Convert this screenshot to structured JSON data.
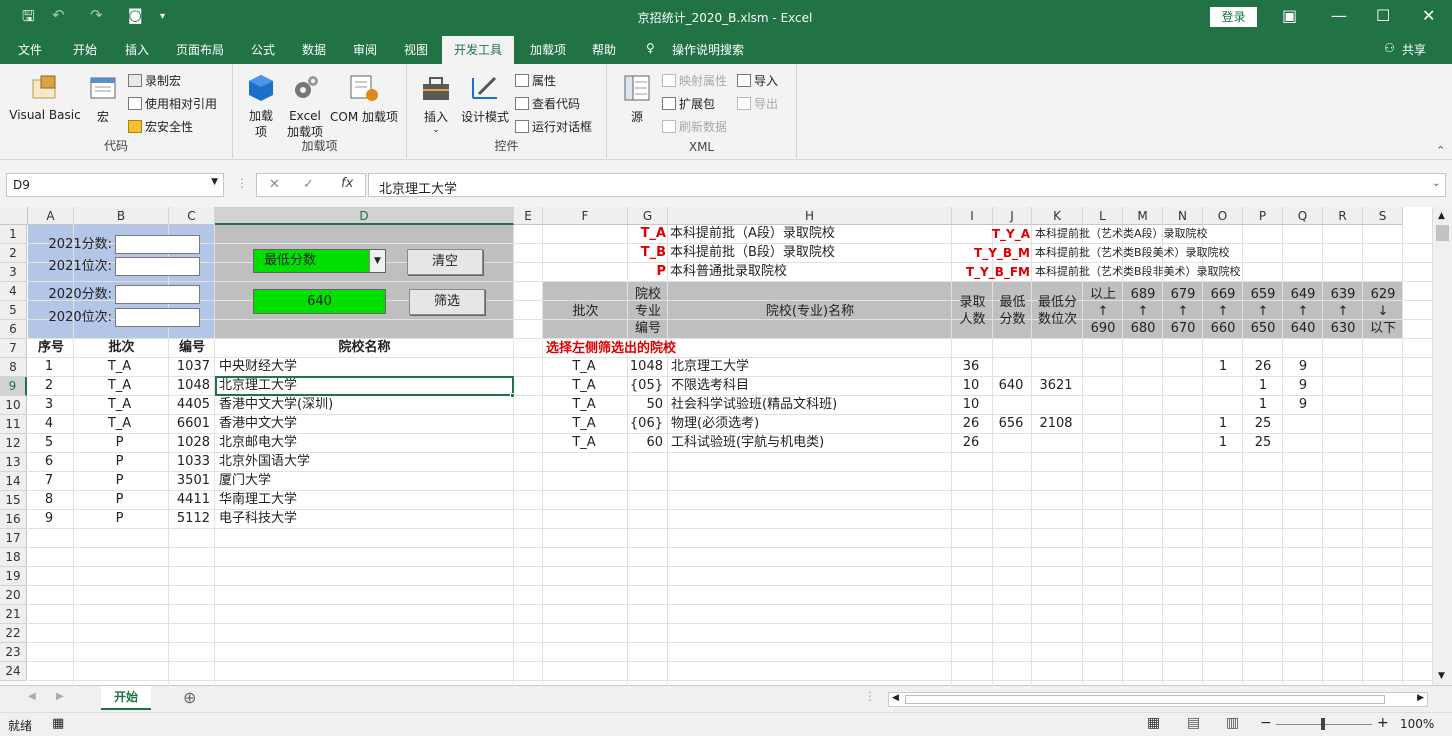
{
  "app": {
    "title": "京招统计_2020_B.xlsm  -  Excel",
    "login": "登录"
  },
  "menu": {
    "tabs": [
      "文件",
      "开始",
      "插入",
      "页面布局",
      "公式",
      "数据",
      "审阅",
      "视图",
      "开发工具",
      "加载项",
      "帮助"
    ],
    "active_tab": "开发工具",
    "search": "操作说明搜索",
    "share": "共享"
  },
  "ribbon": {
    "code": {
      "label": "代码",
      "visual_basic": "Visual Basic",
      "macro": "宏",
      "record": "录制宏",
      "relative": "使用相对引用",
      "security": "宏安全性"
    },
    "addins": {
      "label": "加载项",
      "addin": "加载项",
      "excel_addin": "Excel 加载项",
      "com_addin": "COM 加载项"
    },
    "controls": {
      "label": "控件",
      "insert": "插入",
      "design": "设计模式",
      "props": "属性",
      "view_code": "查看代码",
      "dialog": "运行对话框"
    },
    "xml": {
      "label": "XML",
      "source": "源",
      "map_props": "映射属性",
      "expansion": "扩展包",
      "refresh": "刷新数据",
      "import": "导入",
      "export": "导出"
    }
  },
  "formula": {
    "namebox": "D9",
    "value": "北京理工大学"
  },
  "columns": [
    "A",
    "B",
    "C",
    "D",
    "E",
    "F",
    "G",
    "H",
    "I",
    "J",
    "K",
    "L",
    "M",
    "N",
    "O",
    "P",
    "Q",
    "R",
    "S"
  ],
  "rows": [
    "1",
    "2",
    "3",
    "4",
    "5",
    "6",
    "7",
    "8",
    "9",
    "10",
    "11",
    "12",
    "13",
    "14",
    "15",
    "16",
    "17",
    "18",
    "19",
    "20",
    "21",
    "22",
    "23",
    "24"
  ],
  "panel": {
    "score2021": "2021分数:",
    "rank2021": "2021位次:",
    "score2020": "2020分数:",
    "rank2020": "2020位次:",
    "dropdown": "最低分数",
    "value": "640",
    "clear": "清空",
    "filter": "筛选"
  },
  "left_table": {
    "headers": [
      "序号",
      "批次",
      "编号",
      "院校名称"
    ],
    "rows": [
      [
        "1",
        "T_A",
        "1037",
        "中央财经大学"
      ],
      [
        "2",
        "T_A",
        "1048",
        "北京理工大学"
      ],
      [
        "3",
        "T_A",
        "4405",
        "香港中文大学(深圳)"
      ],
      [
        "4",
        "T_A",
        "6601",
        "香港中文大学"
      ],
      [
        "5",
        "P",
        "1028",
        "北京邮电大学"
      ],
      [
        "6",
        "P",
        "1033",
        "北京外国语大学"
      ],
      [
        "7",
        "P",
        "3501",
        "厦门大学"
      ],
      [
        "8",
        "P",
        "4411",
        "华南理工大学"
      ],
      [
        "9",
        "P",
        "5112",
        "电子科技大学"
      ]
    ]
  },
  "legend": [
    {
      "code": "T_A",
      "desc": "本科提前批（A段）录取院校"
    },
    {
      "code": "T_B",
      "desc": "本科提前批（B段）录取院校"
    },
    {
      "code": "P",
      "desc": "本科普通批录取院校"
    },
    {
      "code": "T_Y_A",
      "desc": "本科提前批（艺术类A段）录取院校"
    },
    {
      "code": "T_Y_B_M",
      "desc": "本科提前批（艺术类B段美术）录取院校"
    },
    {
      "code": "T_Y_B_FM",
      "desc": "本科提前批（艺术类B段非美术）录取院校"
    }
  ],
  "right_header": {
    "batch": "批次",
    "code": "院校\n专业\n编号",
    "name": "院校(专业)名称",
    "enroll": "录取\n人数",
    "min": "最低\n分数",
    "minrank": "最低分\n数位次",
    "bands": [
      "以上\n↑\n690",
      "689\n↑\n680",
      "679\n↑\n670",
      "669\n↑\n660",
      "659\n↑\n650",
      "649\n↑\n640",
      "639\n↑\n630",
      "629\n↓\n以下"
    ]
  },
  "right_title": "选择左侧筛选出的院校",
  "right_rows": [
    {
      "batch": "T_A",
      "code": "1048",
      "name": "北京理工大学",
      "enroll": "36",
      "min": "",
      "rank": "",
      "bands": [
        "",
        "",
        "",
        "1",
        "26",
        "9",
        "",
        ""
      ]
    },
    {
      "batch": "T_A",
      "code": "{05}",
      "name": "不限选考科目",
      "enroll": "10",
      "min": "640",
      "rank": "3621",
      "bands": [
        "",
        "",
        "",
        "",
        "1",
        "9",
        "",
        ""
      ]
    },
    {
      "batch": "T_A",
      "code": "50",
      "name": "社会科学试验班(精品文科班)",
      "enroll": "10",
      "min": "",
      "rank": "",
      "bands": [
        "",
        "",
        "",
        "",
        "1",
        "9",
        "",
        ""
      ]
    },
    {
      "batch": "T_A",
      "code": "{06}",
      "name": "物理(必须选考)",
      "enroll": "26",
      "min": "656",
      "rank": "2108",
      "bands": [
        "",
        "",
        "",
        "1",
        "25",
        "",
        "",
        ""
      ]
    },
    {
      "batch": "T_A",
      "code": "60",
      "name": "工科试验班(宇航与机电类)",
      "enroll": "26",
      "min": "",
      "rank": "",
      "bands": [
        "",
        "",
        "",
        "1",
        "25",
        "",
        "",
        ""
      ]
    }
  ],
  "sheet": {
    "tab": "开始"
  },
  "status": {
    "ready": "就绪",
    "zoom": "100%"
  }
}
